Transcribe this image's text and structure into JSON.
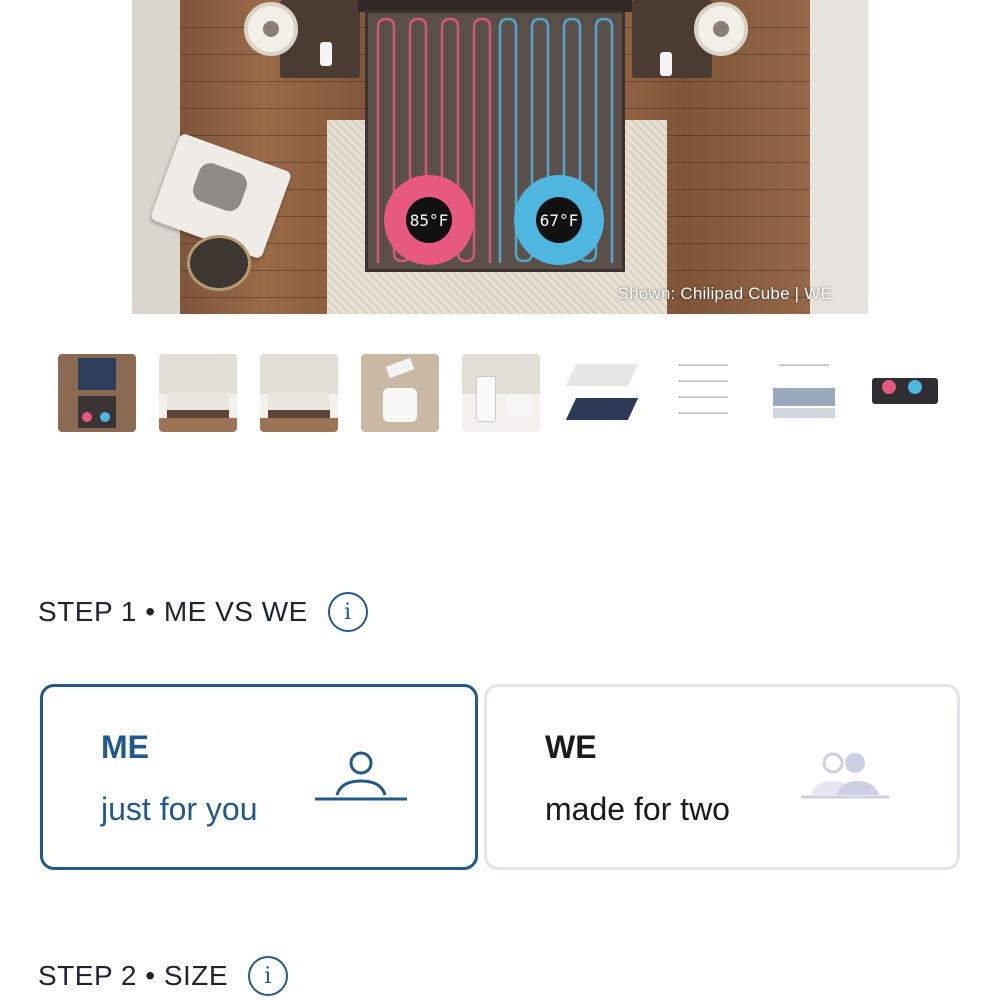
{
  "hero": {
    "caption": "Shown: Chilipad Cube | WE",
    "left_temp": "85°F",
    "right_temp": "67°F",
    "left_color": "#e8597f",
    "right_color": "#4fb6e0"
  },
  "thumbnails": [
    {
      "name": "thumb-dual-pads"
    },
    {
      "name": "thumb-bedroom-1"
    },
    {
      "name": "thumb-bedroom-2"
    },
    {
      "name": "thumb-control-unit"
    },
    {
      "name": "thumb-remote"
    },
    {
      "name": "thumb-pad-comparison"
    },
    {
      "name": "thumb-info-sheet"
    },
    {
      "name": "thumb-cooling-layers"
    },
    {
      "name": "thumb-dual-zone"
    }
  ],
  "step1": {
    "title": "STEP 1 • ME VS WE",
    "info_icon": "i",
    "options": [
      {
        "title": "ME",
        "subtitle": "just for you",
        "selected": true
      },
      {
        "title": "WE",
        "subtitle": "made for two",
        "selected": false
      }
    ]
  },
  "step2": {
    "title": "STEP 2 • SIZE",
    "info_icon": "i"
  },
  "colors": {
    "accent": "#21598c",
    "unselected_border": "#e2e3ef"
  }
}
